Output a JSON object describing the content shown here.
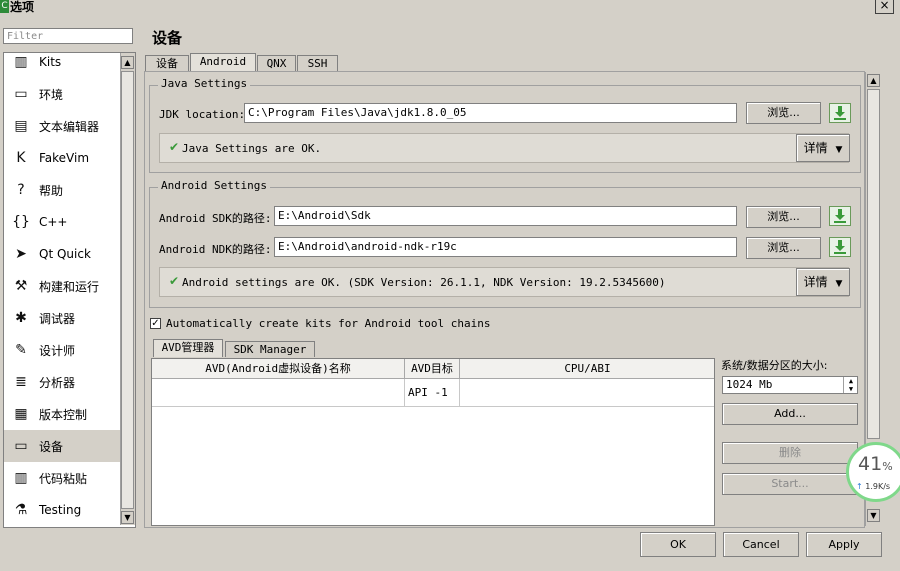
{
  "window": {
    "title": "选项",
    "app_icon": "C",
    "close_symbol": "×"
  },
  "filter": {
    "placeholder": "Filter"
  },
  "sidebar": {
    "items": [
      {
        "label": "Kits",
        "icon": "kits-icon",
        "glyph": "▥"
      },
      {
        "label": "环境",
        "icon": "monitor-icon",
        "glyph": "▭"
      },
      {
        "label": "文本编辑器",
        "icon": "text-editor-icon",
        "glyph": "▤"
      },
      {
        "label": "FakeVim",
        "icon": "fakevim-icon",
        "glyph": "K"
      },
      {
        "label": "帮助",
        "icon": "help-icon",
        "glyph": "?"
      },
      {
        "label": "C++",
        "icon": "braces-icon",
        "glyph": "{}"
      },
      {
        "label": "Qt Quick",
        "icon": "qtquick-icon",
        "glyph": "➤"
      },
      {
        "label": "构建和运行",
        "icon": "hammer-icon",
        "glyph": "⚒"
      },
      {
        "label": "调试器",
        "icon": "bug-icon",
        "glyph": "✱"
      },
      {
        "label": "设计师",
        "icon": "pencil-icon",
        "glyph": "✎"
      },
      {
        "label": "分析器",
        "icon": "analyzer-icon",
        "glyph": "≣"
      },
      {
        "label": "版本控制",
        "icon": "version-control-icon",
        "glyph": "▦"
      },
      {
        "label": "设备",
        "icon": "device-icon",
        "glyph": "▭"
      },
      {
        "label": "代码粘贴",
        "icon": "clipboard-icon",
        "glyph": "▥"
      },
      {
        "label": "Testing",
        "icon": "flask-icon",
        "glyph": "⚗"
      }
    ],
    "selected_index": 12
  },
  "page": {
    "title": "设备"
  },
  "tabs": [
    {
      "label": "设备"
    },
    {
      "label": "Android"
    },
    {
      "label": "QNX"
    },
    {
      "label": "SSH"
    }
  ],
  "active_tab_index": 1,
  "java": {
    "group_title": "Java Settings",
    "jdk_label": "JDK location:",
    "jdk_value": "C:\\Program Files\\Java\\jdk1.8.0_05",
    "browse_label": "浏览...",
    "status_text": "Java Settings are OK.",
    "details_label": "详情"
  },
  "android": {
    "group_title": "Android Settings",
    "sdk_label": "Android SDK的路径:",
    "sdk_value": "E:\\Android\\Sdk",
    "ndk_label": "Android NDK的路径:",
    "ndk_value": "E:\\Android\\android-ndk-r19c",
    "browse_label": "浏览...",
    "status_text": "Android settings are OK.  (SDK Version: 26.1.1, NDK Version: 19.2.5345600)",
    "details_label": "详情"
  },
  "auto_create": {
    "label": "Automatically create kits for Android tool chains",
    "checked": true
  },
  "avd": {
    "tabs": [
      {
        "label": "AVD管理器"
      },
      {
        "label": "SDK Manager"
      }
    ],
    "active_tab_index": 0,
    "columns": [
      "AVD(Android虚拟设备)名称",
      "AVD目标",
      "CPU/ABI"
    ],
    "rows": [
      [
        "",
        "API -1",
        ""
      ]
    ],
    "partition_label": "系统/数据分区的大小:",
    "partition_value": "1024 Mb",
    "add_label": "Add...",
    "delete_label": "删除",
    "start_label": "Start..."
  },
  "net_meter": {
    "percent": "41",
    "percent_sign": "%",
    "speed": "1.9K/s",
    "arrow": "↑"
  },
  "footer": {
    "ok": "OK",
    "cancel": "Cancel",
    "apply": "Apply"
  },
  "colors": {
    "accent_green": "#3a9a3a",
    "meter_ring": "#7fd88a"
  }
}
